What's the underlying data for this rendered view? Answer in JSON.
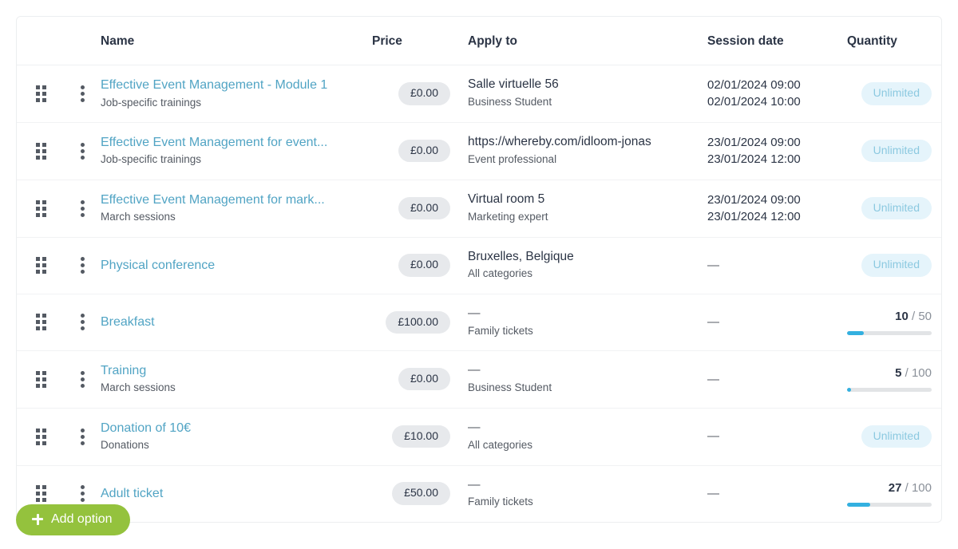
{
  "table": {
    "columns": {
      "drag": "",
      "menu": "",
      "name": "Name",
      "price": "Price",
      "apply_to": "Apply to",
      "session_date": "Session date",
      "quantity": "Quantity"
    },
    "rows": [
      {
        "name": "Effective Event Management - Module 1",
        "subtitle": "Job-specific trainings",
        "price": "£0.00",
        "apply_to": "Salle virtuelle 56",
        "apply_to_sub": "Business Student",
        "session_date_start": "02/01/2024 09:00",
        "session_date_end": "02/01/2024 10:00",
        "quantity_type": "unlimited",
        "quantity_label": "Unlimited"
      },
      {
        "name": "Effective Event Management for event...",
        "subtitle": "Job-specific trainings",
        "price": "£0.00",
        "apply_to": "https://whereby.com/idloom-jonas",
        "apply_to_sub": "Event professional",
        "session_date_start": "23/01/2024 09:00",
        "session_date_end": "23/01/2024 12:00",
        "quantity_type": "unlimited",
        "quantity_label": "Unlimited"
      },
      {
        "name": "Effective Event Management for mark...",
        "subtitle": "March sessions",
        "price": "£0.00",
        "apply_to": "Virtual room 5",
        "apply_to_sub": "Marketing expert",
        "session_date_start": "23/01/2024 09:00",
        "session_date_end": "23/01/2024 12:00",
        "quantity_type": "unlimited",
        "quantity_label": "Unlimited"
      },
      {
        "name": "Physical conference",
        "subtitle": "",
        "price": "£0.00",
        "apply_to": "Bruxelles, Belgique",
        "apply_to_sub": "All categories",
        "session_date_start": "—",
        "session_date_end": "",
        "quantity_type": "unlimited",
        "quantity_label": "Unlimited"
      },
      {
        "name": "Breakfast",
        "subtitle": "",
        "price": "£100.00",
        "apply_to": "—",
        "apply_to_sub": "Family tickets",
        "session_date_start": "—",
        "session_date_end": "",
        "quantity_type": "counted",
        "quantity_used": "10",
        "quantity_total": "50",
        "quantity_percent": 20
      },
      {
        "name": "Training",
        "subtitle": "March sessions",
        "price": "£0.00",
        "apply_to": "—",
        "apply_to_sub": "Business Student",
        "session_date_start": "—",
        "session_date_end": "",
        "quantity_type": "counted",
        "quantity_used": "5",
        "quantity_total": "100",
        "quantity_percent": 5
      },
      {
        "name": "Donation of 10€",
        "subtitle": "Donations",
        "price": "£10.00",
        "apply_to": "—",
        "apply_to_sub": "All categories",
        "session_date_start": "—",
        "session_date_end": "",
        "quantity_type": "unlimited",
        "quantity_label": "Unlimited"
      },
      {
        "name": "Adult ticket",
        "subtitle": "",
        "price": "£50.00",
        "apply_to": "—",
        "apply_to_sub": "Family tickets",
        "session_date_start": "—",
        "session_date_end": "",
        "quantity_type": "counted",
        "quantity_used": "27",
        "quantity_total": "100",
        "quantity_percent": 27
      }
    ]
  },
  "footer": {
    "add_option_label": "Add option"
  },
  "colors": {
    "link": "#51a4c4",
    "accent_green": "#94c23d",
    "progress_blue": "#33b0e0",
    "badge_unlimited_bg": "#e5f4fb",
    "badge_unlimited_text": "#8cc9e0",
    "price_pill_bg": "#e7e9ec",
    "heading_text": "#2b3445"
  },
  "icons": {
    "drag": "drag-handle-icon",
    "menu": "kebab-menu-icon",
    "add": "plus-icon"
  }
}
